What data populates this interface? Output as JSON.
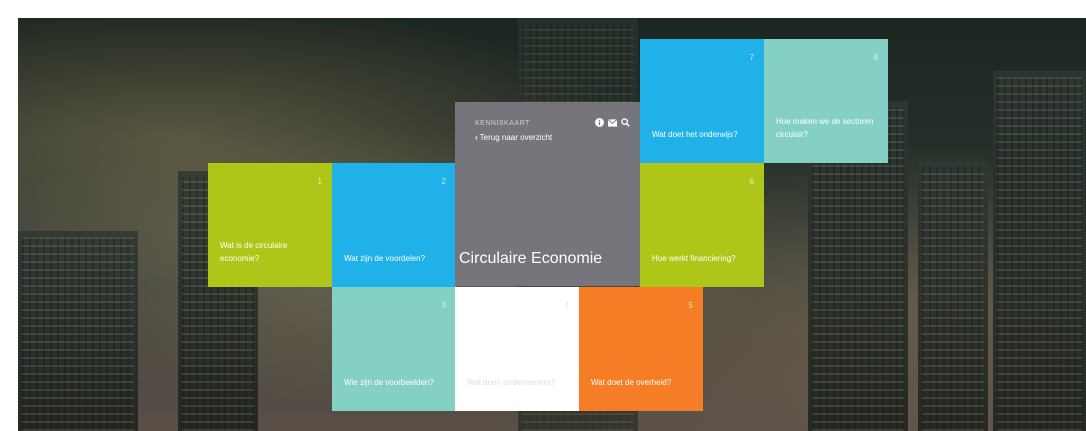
{
  "main": {
    "kenniskaart_label": "KENNISKAART",
    "back_label": "Terug naar overzicht",
    "title": "Circulaire Economie",
    "icons": [
      "info-icon",
      "mail-icon",
      "search-icon"
    ]
  },
  "tiles": [
    {
      "num": "1",
      "label": "Wat is de circulaire economie?",
      "color": "#afc618"
    },
    {
      "num": "2",
      "label": "Wat zijn de voordelen?",
      "color": "#20b1e8"
    },
    {
      "num": "3",
      "label": "Wie zijn de voorbeelden?",
      "color": "#85d0c4"
    },
    {
      "num": "4",
      "label": "Wat doen ondernemers?",
      "color": "#ffffff"
    },
    {
      "num": "5",
      "label": "Wat doet de overheid?",
      "color": "#f47d25"
    },
    {
      "num": "6",
      "label": "Hoe werkt financiering?",
      "color": "#afc618"
    },
    {
      "num": "7",
      "label": "Wat doet het onderwijs?",
      "color": "#20b1e8"
    },
    {
      "num": "8",
      "label": "Hoe maken we de sectoren circulair?",
      "color": "#85d0c4"
    }
  ]
}
